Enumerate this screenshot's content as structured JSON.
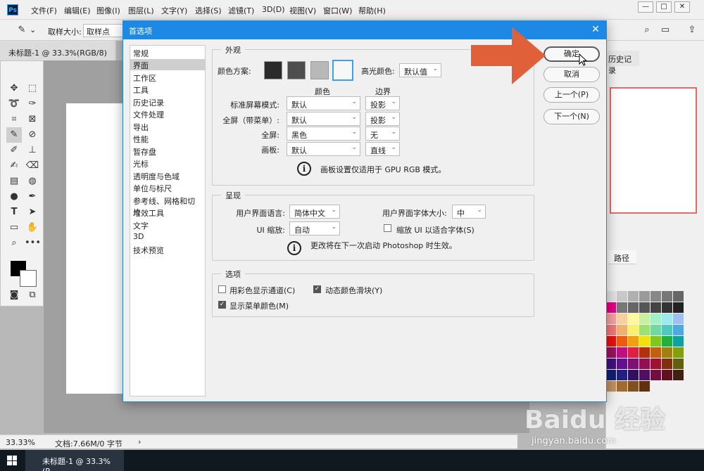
{
  "app": {
    "logo": "Ps",
    "menu": [
      "文件(F)",
      "编辑(E)",
      "图像(I)",
      "图层(L)",
      "文字(Y)",
      "选择(S)",
      "滤镜(T)",
      "3D(D)",
      "视图(V)",
      "窗口(W)",
      "帮助(H)"
    ],
    "options_bar": {
      "sample_size_label": "取样大小:",
      "sample_size_value": "取样点"
    },
    "document_tab": "未标题-1 @ 33.3%(RGB/8)",
    "status_zoom": "33.33%",
    "status_doc": "文档:7.66M/0 字节",
    "history_panel_tab": "历史记录",
    "paths_tab": "路径",
    "taskbar_item": "未标题-1 @ 33.3%(R...",
    "watermark": "Baidu 经验",
    "watermark_url": "jingyan.baidu.com"
  },
  "dialog": {
    "title": "首选项",
    "categories": [
      "常规",
      "界面",
      "工作区",
      "工具",
      "历史记录",
      "文件处理",
      "导出",
      "性能",
      "暂存盘",
      "光标",
      "透明度与色域",
      "单位与标尺",
      "参考线、网格和切片",
      "增效工具",
      "文字",
      "3D",
      "技术预览"
    ],
    "active_category": "界面",
    "appearance": {
      "title": "外观",
      "color_scheme_label": "颜色方案:",
      "scheme_colors": [
        "#2b2b2b",
        "#4e4e4e",
        "#b8b8b8",
        "#f7f7f7"
      ],
      "highlight_label": "高光颜色:",
      "highlight_value": "默认值",
      "col_color": "颜色",
      "col_border": "边界",
      "rows": [
        {
          "label": "标准屏幕模式:",
          "color": "默认",
          "border": "投影"
        },
        {
          "label": "全屏（带菜单）:",
          "color": "默认",
          "border": "投影"
        },
        {
          "label": "全屏:",
          "color": "黑色",
          "border": "无"
        },
        {
          "label": "画板:",
          "color": "默认",
          "border": "直线"
        }
      ],
      "note": "画板设置仅适用于 GPU RGB 模式。"
    },
    "presentation": {
      "title": "呈现",
      "ui_language_label": "用户界面语言:",
      "ui_language_value": "简体中文",
      "ui_font_size_label": "用户界面字体大小:",
      "ui_font_size_value": "中",
      "ui_scale_label": "UI 缩放:",
      "ui_scale_value": "自动",
      "scale_fit_label": "缩放 UI 以适合字体(S)",
      "note": "更改将在下一次启动 Photoshop 时生效。"
    },
    "options": {
      "title": "选项",
      "show_channels_color": "用彩色显示通道(C)",
      "dynamic_sliders": "动态颜色滑块(Y)",
      "show_menu_colors": "显示菜单颜色(M)"
    },
    "buttons": {
      "ok": "确定",
      "cancel": "取消",
      "prev": "上一个(P)",
      "next": "下一个(N)"
    }
  }
}
